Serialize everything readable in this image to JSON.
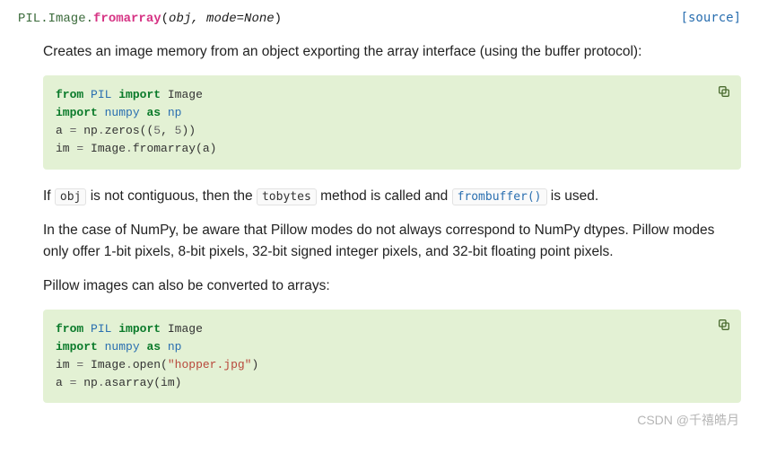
{
  "signature": {
    "module": "PIL.Image.",
    "name": "fromarray",
    "params": "obj, mode=None"
  },
  "source_link": "[source]",
  "paragraphs": {
    "intro": "Creates an image memory from an object exporting the array interface (using the buffer protocol):",
    "p2_a": "If ",
    "p2_code1": "obj",
    "p2_b": " is not contiguous, then the ",
    "p2_code2": "tobytes",
    "p2_c": " method is called and ",
    "p2_link": "frombuffer()",
    "p2_d": " is used.",
    "p3": "In the case of NumPy, be aware that Pillow modes do not always correspond to NumPy dtypes. Pillow modes only offer 1-bit pixels, 8-bit pixels, 32-bit signed integer pixels, and 32-bit floating point pixels.",
    "p4": "Pillow images can also be converted to arrays:"
  },
  "code1": {
    "l1": {
      "kw1": "from",
      "mod": "PIL",
      "kw2": "import",
      "name": "Image"
    },
    "l2": {
      "kw1": "import",
      "mod": "numpy",
      "kw2": "as",
      "alias": "np"
    },
    "l3_a": "a ",
    "l3_op": "=",
    "l3_b": " np",
    "l3_dot": ".",
    "l3_c": "zeros((",
    "l3_n1": "5",
    "l3_com": ", ",
    "l3_n2": "5",
    "l3_cp": "))",
    "l4_a": "im ",
    "l4_op": "=",
    "l4_b": " Image",
    "l4_dot": ".",
    "l4_c": "fromarray(a)"
  },
  "code2": {
    "l1": {
      "kw1": "from",
      "mod": "PIL",
      "kw2": "import",
      "name": "Image"
    },
    "l2": {
      "kw1": "import",
      "mod": "numpy",
      "kw2": "as",
      "alias": "np"
    },
    "l3_a": "im ",
    "l3_op": "=",
    "l3_b": " Image",
    "l3_dot": ".",
    "l3_c": "open(",
    "l3_str": "\"hopper.jpg\"",
    "l3_cp": ")",
    "l4_a": "a ",
    "l4_op": "=",
    "l4_b": " np",
    "l4_dot": ".",
    "l4_c": "asarray(im)"
  },
  "watermark": "CSDN @千禧皓月"
}
